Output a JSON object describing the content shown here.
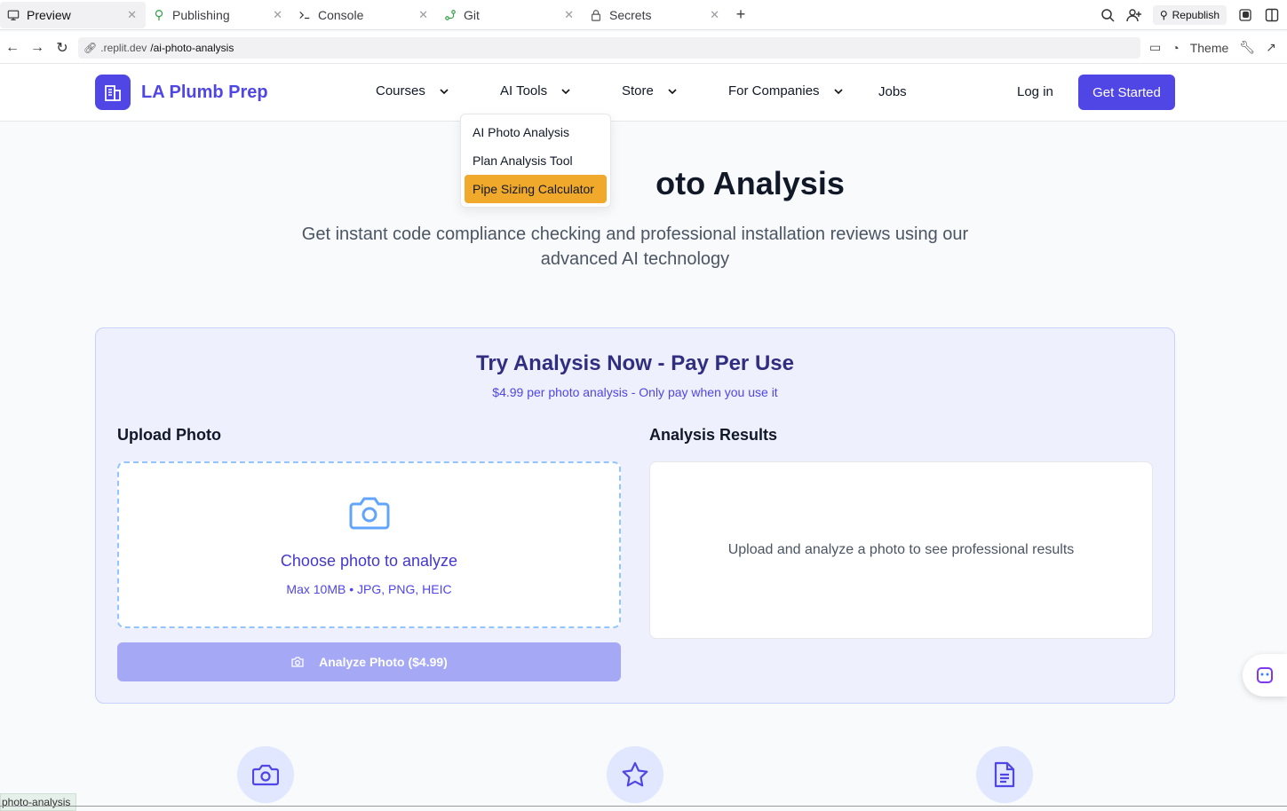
{
  "tabs": [
    {
      "label": "Preview",
      "icon": "monitor-icon",
      "active": true
    },
    {
      "label": "Publishing",
      "icon": "publishing-icon"
    },
    {
      "label": "Console",
      "icon": "terminal-icon"
    },
    {
      "label": "Git",
      "icon": "git-icon"
    },
    {
      "label": "Secrets",
      "icon": "lock-icon"
    }
  ],
  "chrome": {
    "republish": "Republish",
    "theme": "Theme"
  },
  "url": {
    "domain": ".replit.dev",
    "path": "/ai-photo-analysis"
  },
  "site": {
    "brand": "LA Plumb Prep",
    "nav": {
      "courses": "Courses",
      "ai_tools": "AI Tools",
      "store": "Store",
      "companies": "For Companies",
      "jobs": "Jobs"
    },
    "login": "Log in",
    "cta": "Get Started",
    "dropdown": [
      "AI Photo Analysis",
      "Plan Analysis Tool",
      "Pipe Sizing Calculator"
    ],
    "accent": "#4f46e5",
    "highlight": "#f0a92a"
  },
  "hero": {
    "title_visible": "oto Analysis",
    "subtitle": "Get instant code compliance checking and professional installation reviews using our advanced AI technology"
  },
  "card": {
    "title": "Try Analysis Now - Pay Per Use",
    "subtitle": "$4.99 per photo analysis - Only pay when you use it",
    "upload_heading": "Upload Photo",
    "results_heading": "Analysis Results",
    "choose": "Choose photo to analyze",
    "limits": "Max 10MB • JPG, PNG, HEIC",
    "analyze_button": "Analyze Photo ($4.99)",
    "results_placeholder": "Upload and analyze a photo to see professional results"
  },
  "status_url": "photo-analysis"
}
